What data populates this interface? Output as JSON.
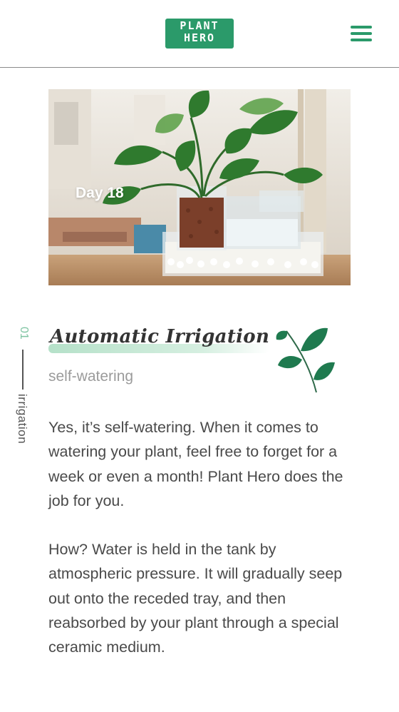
{
  "header": {
    "logo_line1": "PLANT",
    "logo_line2": "HERO",
    "menu_icon": "hamburger-menu-icon",
    "brand_color": "#2b9a6a"
  },
  "hero": {
    "caption": "Day 18"
  },
  "section": {
    "number": "01",
    "label": "irrigation",
    "title": "Automatic Irrigation",
    "subtitle": "self-watering",
    "icon": "leaf-branch-icon",
    "accent_color": "#7fc4a2",
    "paragraphs": [
      "Yes, it’s self-watering. When it comes to watering your plant, feel free to forget for a week or even a month! Plant Hero does the job for you.",
      "How? Water is held in the tank by atmospheric pressure. It will gradually seep out onto the receded tray, and then reabsorbed by your plant through a special ceramic medium."
    ]
  }
}
